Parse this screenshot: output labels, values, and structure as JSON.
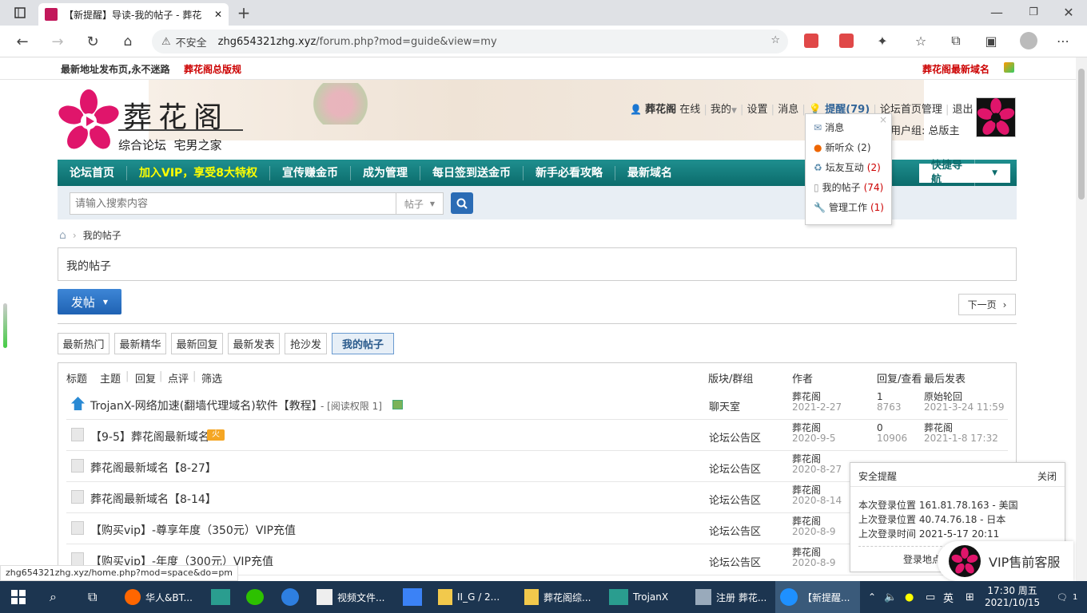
{
  "browser": {
    "tab_title": "【新提醒】导读-我的帖子 - 葬花",
    "security": "不安全",
    "url_host": "zhg654321zhg.xyz",
    "url_path": "/forum.php?mod=guide&view=my",
    "status_url": "zhg654321zhg.xyz/home.php?mod=space&do=pm"
  },
  "topline": {
    "left": "最新地址发布页,永不迷路",
    "left_link": "葬花阁总版规",
    "right_link": "葬花阁最新域名"
  },
  "logo": {
    "title": "葬花阁",
    "subtitle": "综合论坛  宅男之家"
  },
  "userbar": {
    "username": "葬花阁",
    "online": "在线",
    "my": "我的",
    "settings": "设置",
    "messages": "消息",
    "notify": "提醒(79)",
    "admin": "论坛首页管理",
    "logout": "退出",
    "group": "用户组: 总版主"
  },
  "notify_menu": {
    "items": [
      {
        "label": "消息",
        "count": ""
      },
      {
        "label": "新听众",
        "count": "(2)"
      },
      {
        "label": "坛友互动",
        "count": "(2)"
      },
      {
        "label": "我的帖子",
        "count": "(74)"
      },
      {
        "label": "管理工作",
        "count": "(1)"
      }
    ]
  },
  "nav": {
    "items": [
      "论坛首页",
      "加入VIP，享受8大特权",
      "宣传赚金币",
      "成为管理",
      "每日签到送金币",
      "新手必看攻略",
      "最新域名"
    ],
    "quicknav": "快捷导航"
  },
  "search": {
    "placeholder": "请输入搜索内容",
    "type": "帖子"
  },
  "breadcrumb": {
    "current": "我的帖子"
  },
  "page_title": "我的帖子",
  "post_button": "发帖",
  "next_page": "下一页",
  "tabs": [
    "最新热门",
    "最新精华",
    "最新回复",
    "最新发表",
    "抢沙发",
    "我的帖子"
  ],
  "list_header": {
    "title": "标题",
    "subject": "主题",
    "reply": "回复",
    "comment": "点评",
    "filter": "筛选",
    "forum": "版块/群组",
    "author": "作者",
    "stats": "回复/查看",
    "last": "最后发表"
  },
  "threads": [
    {
      "title": "TrojanX-网络加速(翻墙代理域名)软件【教程】",
      "extra": "- [阅读权限 1]",
      "forum": "聊天室",
      "author": "葬花阁",
      "date": "2021-2-27",
      "replies": "1",
      "views": "8763",
      "last_user": "原始轮回",
      "last_time": "2021-3-24 11:59"
    },
    {
      "title": "【9-5】葬花阁最新域名",
      "extra": "",
      "forum": "论坛公告区",
      "author": "葬花阁",
      "date": "2020-9-5",
      "replies": "0",
      "views": "10906",
      "last_user": "葬花阁",
      "last_time": "2021-1-8 17:32"
    },
    {
      "title": "葬花阁最新域名【8-27】",
      "extra": "",
      "forum": "论坛公告区",
      "author": "葬花阁",
      "date": "2020-8-27",
      "replies": "0",
      "views": "",
      "last_user": "葬花阁",
      "last_time": ""
    },
    {
      "title": "葬花阁最新域名【8-14】",
      "extra": "",
      "forum": "论坛公告区",
      "author": "葬花阁",
      "date": "2020-8-14",
      "replies": "",
      "views": "",
      "last_user": "",
      "last_time": ""
    },
    {
      "title": "【购买vip】-尊享年度（350元）VIP充值",
      "extra": "",
      "forum": "论坛公告区",
      "author": "葬花阁",
      "date": "2020-8-9",
      "replies": "",
      "views": "",
      "last_user": "",
      "last_time": ""
    },
    {
      "title": "【购买vip】-年度（300元）VIP充值",
      "extra": "",
      "forum": "论坛公告区",
      "author": "葬花阁",
      "date": "2020-8-9",
      "replies": "",
      "views": "",
      "last_user": "",
      "last_time": ""
    }
  ],
  "security_popup": {
    "title": "安全提醒",
    "close": "关闭",
    "line1": "本次登录位置 161.81.78.163 - 美国",
    "line2": "上次登录位置 40.74.76.18 - 日本",
    "line3": "上次登录时间 2021-5-17 20:11",
    "footer": "登录地点"
  },
  "vip_service": "VIP售前客服",
  "taskbar": {
    "items": [
      "华人&BT...",
      "视频文件...",
      "II_G / 2...",
      "葬花阁综...",
      "TrojanX",
      "注册 葬花...",
      "【新提醒..."
    ],
    "ime": "英",
    "time": "17:30 周五",
    "date": "2021/10/15",
    "badge": "1"
  }
}
